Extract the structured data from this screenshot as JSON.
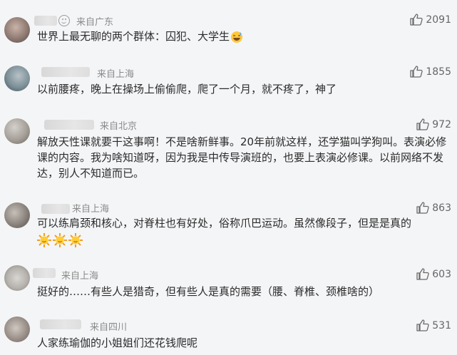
{
  "comments": [
    {
      "location": "来自广东",
      "likes": "2091",
      "text": "世界上最无聊的两个群体：囚犯、大学生"
    },
    {
      "location": "来自上海",
      "likes": "1855",
      "text": "以前腰疼，晚上在操场上偷偷爬，爬了一个月，就不疼了，神了"
    },
    {
      "location": "来自北京",
      "likes": "972",
      "text": "解放天性课就要干这事啊！不是啥新鲜事。20年前就这样，还学猫叫学狗叫。表演必修课的内容。我为啥知道呀，因为我是中传导演班的，也要上表演必修课。以前网络不发达，别人不知道而已。"
    },
    {
      "location": "来自上海",
      "likes": "863",
      "text": "可以练肩颈和核心，对脊柱也有好处，俗称爪巴运动。虽然像段子，但是是真的"
    },
    {
      "location": "来自上海",
      "likes": "603",
      "text": "挺好的……有些人是猎奇，但有些人是真的需要（腰、脊椎、颈椎啥的）"
    },
    {
      "location": "来自四川",
      "likes": "531",
      "text": "人家练瑜伽的小姐姐们还花钱爬呢"
    }
  ],
  "icons": {
    "like": "thumbs-up-icon",
    "emoji_smile": "smile-icon",
    "emoji_sweat": "sweat-laugh-emoji",
    "emoji_sun": "sun-emoji"
  }
}
